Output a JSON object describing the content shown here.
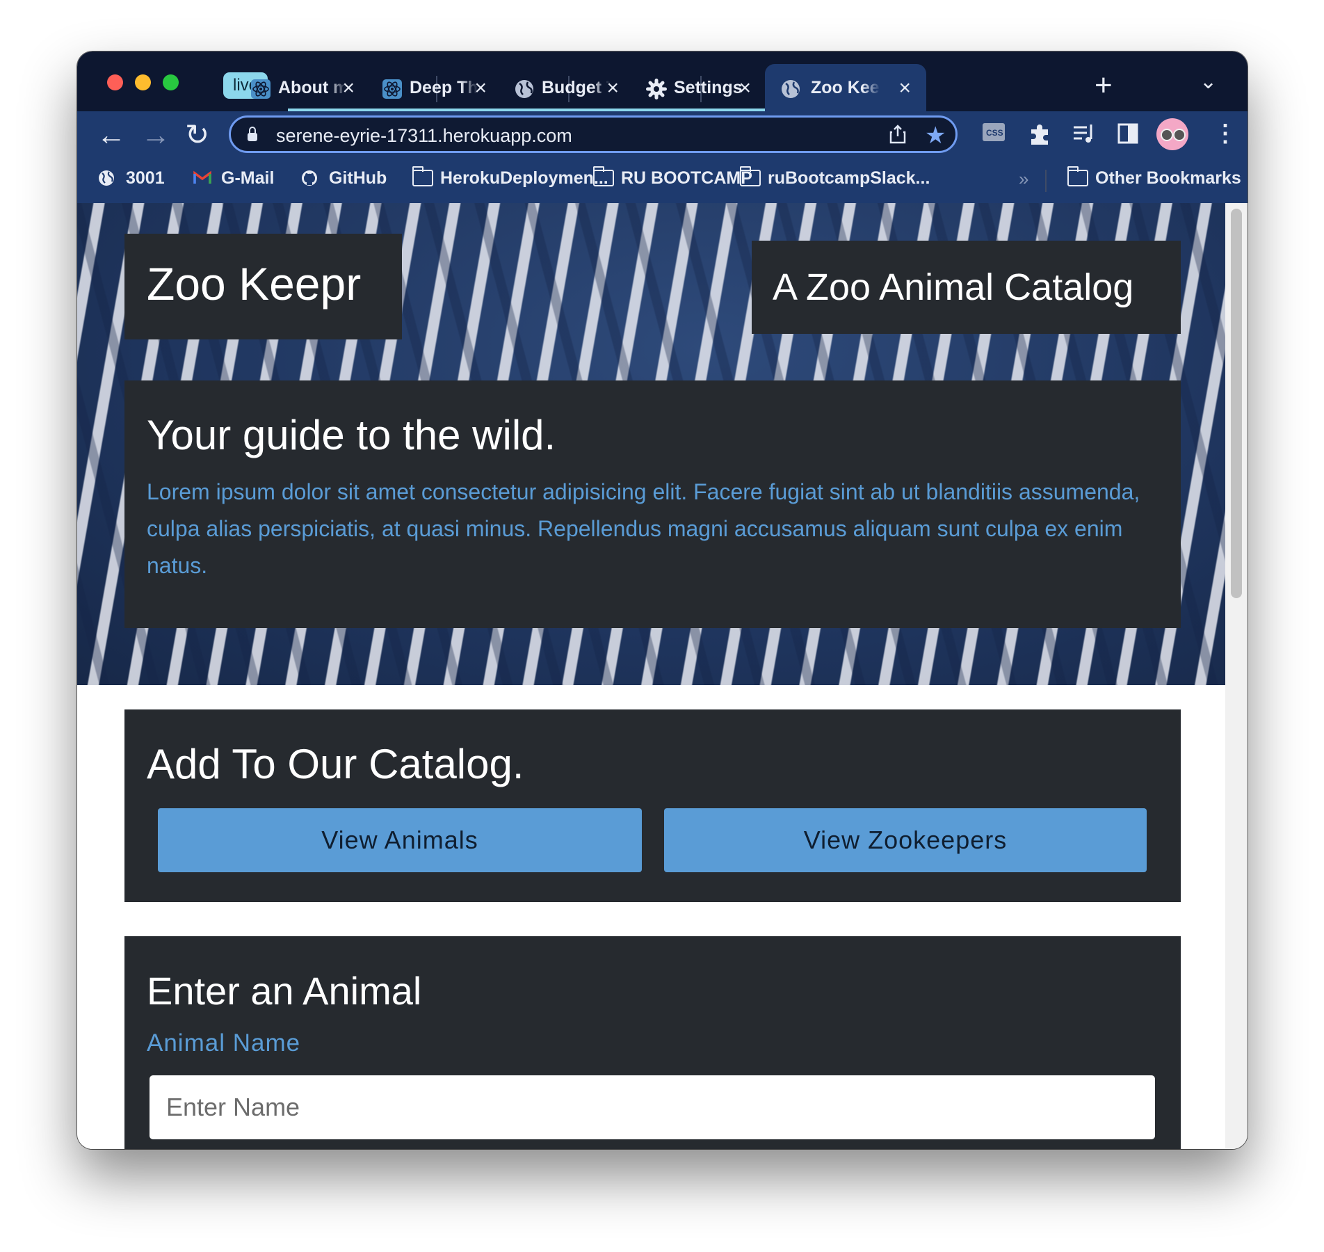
{
  "browser": {
    "tab_group_label": "live",
    "tabs": [
      {
        "label": "About me",
        "icon": "react-icon"
      },
      {
        "label": "Deep Thoughts",
        "icon": "react-icon"
      },
      {
        "label": "Budget Tracker",
        "icon": "globe-icon"
      },
      {
        "label": "Settings",
        "icon": "gear-icon"
      },
      {
        "label": "Zoo Keepr",
        "icon": "globe-icon",
        "active": true
      }
    ],
    "new_tab_label": "+",
    "url": "serene-eyrie-17311.herokuapp.com",
    "bookmarks": [
      {
        "label": "3001",
        "icon": "globe-icon"
      },
      {
        "label": "G-Mail",
        "icon": "gmail-icon"
      },
      {
        "label": "GitHub",
        "icon": "github-icon"
      },
      {
        "label": "HerokuDeploymen...",
        "icon": "folder-icon"
      },
      {
        "label": "RU BOOTCAMP",
        "icon": "folder-icon"
      },
      {
        "label": "ruBootcampSlack...",
        "icon": "folder-icon"
      }
    ],
    "bookmarks_overflow": "»",
    "other_bookmarks": "Other Bookmarks"
  },
  "page": {
    "site_title": "Zoo Keepr",
    "site_subtitle": "A Zoo Animal Catalog",
    "intro": {
      "heading": "Your guide to the wild.",
      "body": "Lorem ipsum dolor sit amet consectetur adipisicing elit. Facere fugiat sint ab ut blanditiis assumenda, culpa alias perspiciatis, at quasi minus. Repellendus magni accusamus aliquam sunt culpa ex enim natus."
    },
    "catalog": {
      "heading": "Add To Our Catalog.",
      "view_animals": "View Animals",
      "view_zookeepers": "View Zookeepers"
    },
    "form": {
      "heading": "Enter an Animal",
      "name_label": "Animal Name",
      "name_placeholder": "Enter Name"
    }
  },
  "colors": {
    "accent": "#5a9cd6",
    "panel": "#262a2f",
    "toolbar": "#1e3a6e",
    "tabstrip": "#0d1730"
  }
}
